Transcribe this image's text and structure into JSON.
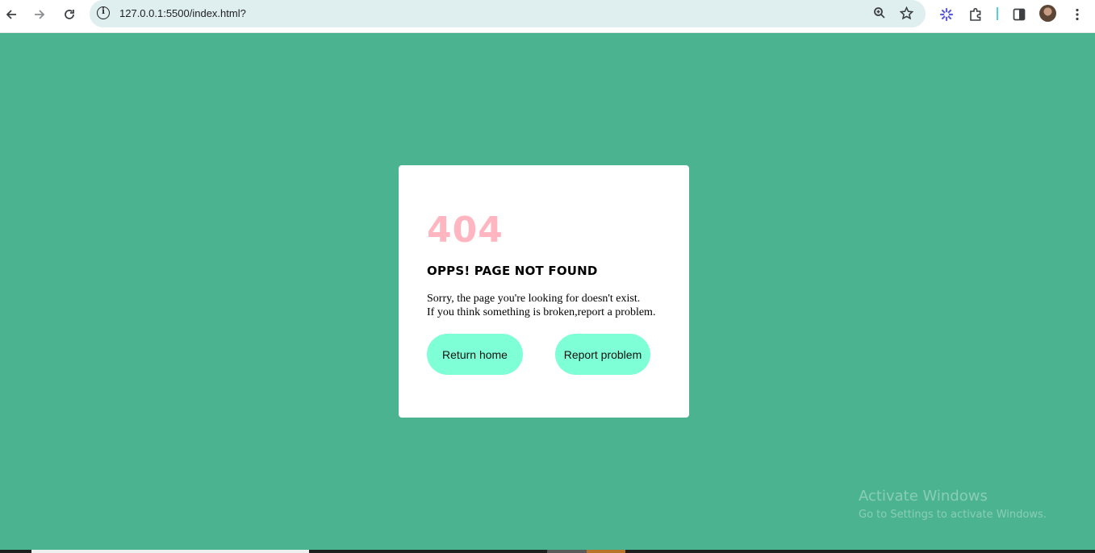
{
  "browser": {
    "url": "127.0.0.1:5500/index.html?",
    "icons": {
      "back": "back-arrow-icon",
      "forward": "forward-arrow-icon",
      "reload": "reload-icon",
      "site_info": "info-icon",
      "zoom": "zoom-icon",
      "bookmark": "star-icon",
      "extension_a": "extension-flower-icon",
      "extensions": "puzzle-icon",
      "side_panel": "side-panel-icon",
      "profile": "avatar",
      "menu": "kebab-menu-icon"
    }
  },
  "error_page": {
    "code": "404",
    "heading": "OPPS! PAGE NOT FOUND",
    "message_line1": "Sorry, the page you're looking for doesn't exist.",
    "message_line2": "If you think something is broken,report a problem.",
    "return_home_label": "Return home",
    "report_problem_label": "Report problem"
  },
  "watermark": {
    "title": "Activate Windows",
    "subtitle": "Go to Settings to activate Windows."
  },
  "colors": {
    "page_background": "#4bb38f",
    "card_background": "#ffffff",
    "code_color": "#ffb6c1",
    "button_color": "#7effd5"
  }
}
